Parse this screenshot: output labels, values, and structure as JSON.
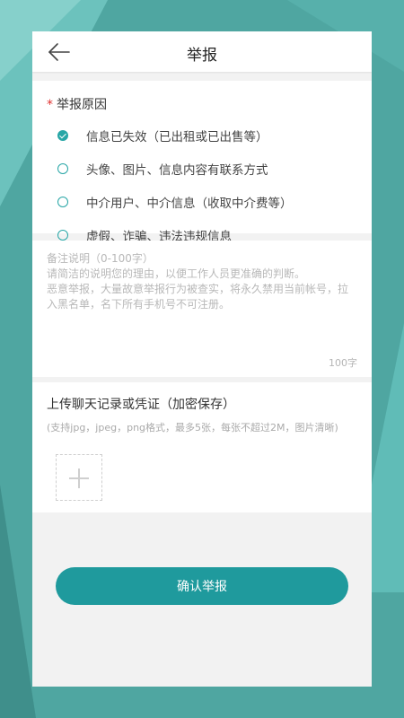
{
  "header": {
    "title": "举报"
  },
  "reasons": {
    "label": "举报原因",
    "options": [
      {
        "text": "信息已失效（已出租或已出售等）",
        "checked": true
      },
      {
        "text": "头像、图片、信息内容有联系方式",
        "checked": false
      },
      {
        "text": "中介用户、中介信息（收取中介费等）",
        "checked": false
      },
      {
        "text": "虚假、诈骗、违法违规信息",
        "checked": false
      }
    ]
  },
  "remark": {
    "placeholder": "备注说明（0-100字）\n请简洁的说明您的理由，以便工作人员更准确的判断。\n恶意举报，大量故意举报行为被查实，将永久禁用当前帐号，拉入黑名单，名下所有手机号不可注册。",
    "value": "",
    "counter": "100字"
  },
  "upload": {
    "title": "上传聊天记录或凭证（加密保存）",
    "hint": "(支持jpg，jpeg，png格式，最多5张，每张不超过2M，图片清晰)"
  },
  "submit": {
    "label": "确认举报"
  },
  "colors": {
    "accent": "#1f9a9d",
    "required": "#e0312f",
    "background": "#4fa6a1"
  }
}
